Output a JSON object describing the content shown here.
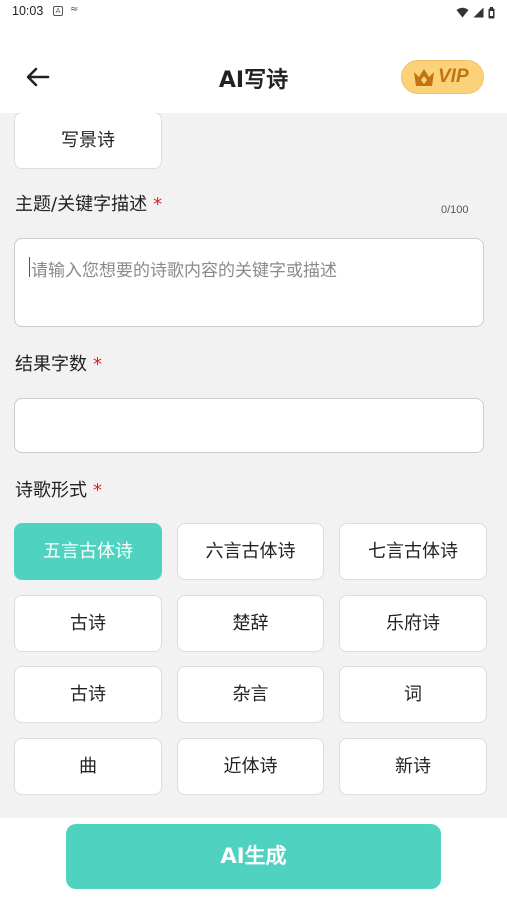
{
  "status_bar": {
    "time": "10:03",
    "icon_a": "A",
    "icon_b": "≈"
  },
  "header": {
    "title": "AI写诗",
    "vip_label": "VIP"
  },
  "top_chip": "写景诗",
  "topic": {
    "label": "主题/关键字描述",
    "required_mark": "*",
    "counter": "0/100",
    "placeholder": "请输入您想要的诗歌内容的关键字或描述"
  },
  "count": {
    "label": "结果字数",
    "required_mark": "*",
    "value": ""
  },
  "form": {
    "label": "诗歌形式",
    "required_mark": "*",
    "options": [
      "五言古体诗",
      "六言古体诗",
      "七言古体诗",
      "古诗",
      "楚辞",
      "乐府诗",
      "古诗",
      "杂言",
      "词",
      "曲",
      "近体诗",
      "新诗"
    ],
    "selected": "五言古体诗"
  },
  "footer": {
    "generate_label": "AI生成"
  },
  "colors": {
    "accent": "#4fd3c0",
    "vip_bg": "#fbd27a",
    "vip_text": "#c27411",
    "required": "#e02020"
  },
  "icons": [
    "arrow-left-icon",
    "crown-icon",
    "wifi-icon",
    "signal-icon",
    "battery-icon"
  ]
}
